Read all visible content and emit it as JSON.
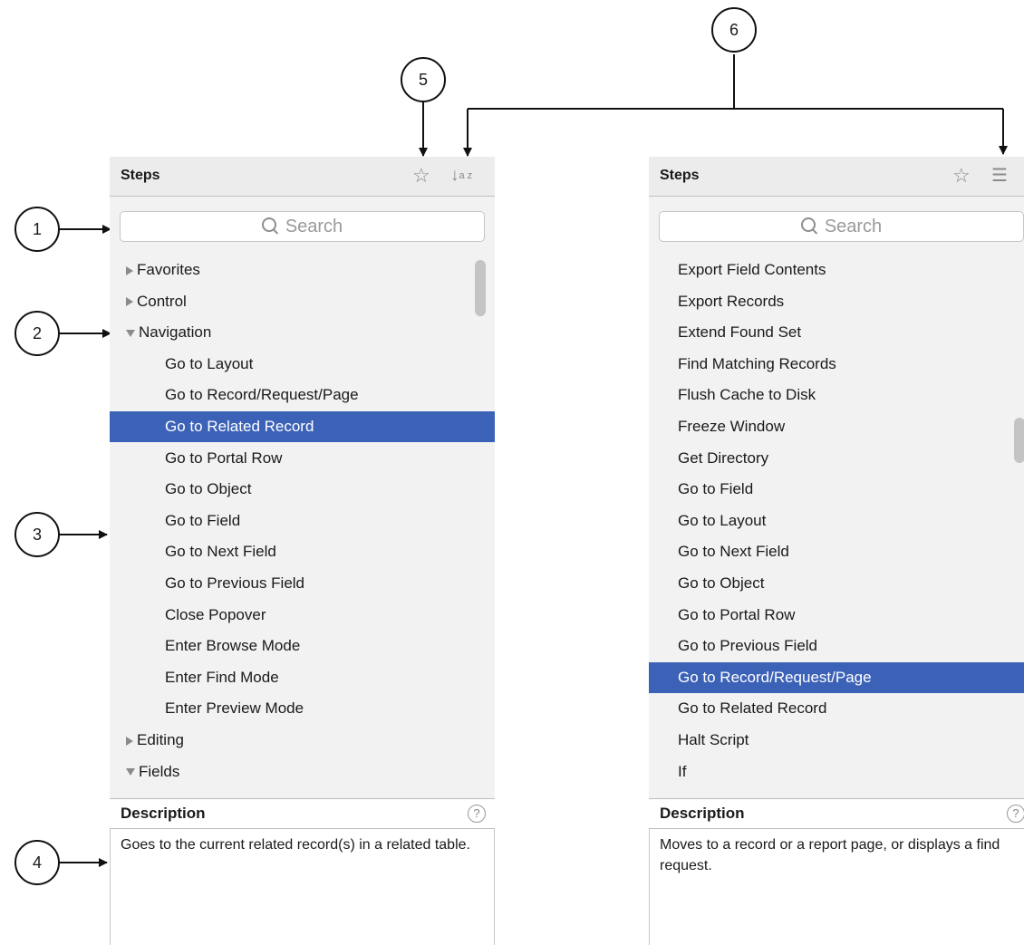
{
  "callouts": [
    "1",
    "2",
    "3",
    "4",
    "5",
    "6"
  ],
  "left_panel": {
    "title": "Steps",
    "favorite_icon": "star-icon",
    "sort_icon": "sort-alpha-icon",
    "search_placeholder": "Search",
    "items": [
      {
        "label": "Favorites",
        "level": 0,
        "state": "collapsed"
      },
      {
        "label": "Control",
        "level": 0,
        "state": "collapsed"
      },
      {
        "label": "Navigation",
        "level": 0,
        "state": "expanded"
      },
      {
        "label": "Go to Layout",
        "level": 1
      },
      {
        "label": "Go to Record/Request/Page",
        "level": 1
      },
      {
        "label": "Go to Related Record",
        "level": 1,
        "selected": true
      },
      {
        "label": "Go to Portal Row",
        "level": 1
      },
      {
        "label": "Go to Object",
        "level": 1
      },
      {
        "label": "Go to Field",
        "level": 1
      },
      {
        "label": "Go to Next Field",
        "level": 1
      },
      {
        "label": "Go to Previous Field",
        "level": 1
      },
      {
        "label": "Close Popover",
        "level": 1
      },
      {
        "label": "Enter Browse Mode",
        "level": 1
      },
      {
        "label": "Enter Find Mode",
        "level": 1
      },
      {
        "label": "Enter Preview Mode",
        "level": 1
      },
      {
        "label": "Editing",
        "level": 0,
        "state": "collapsed"
      },
      {
        "label": "Fields",
        "level": 0,
        "state": "expanded"
      }
    ],
    "description_title": "Description",
    "description_text": "Goes to the current related record(s) in a related table."
  },
  "right_panel": {
    "title": "Steps",
    "favorite_icon": "star-icon",
    "view_icon": "list-view-icon",
    "search_placeholder": "Search",
    "items": [
      {
        "label": "Export Field Contents"
      },
      {
        "label": "Export Records"
      },
      {
        "label": "Extend Found Set"
      },
      {
        "label": "Find Matching Records"
      },
      {
        "label": "Flush Cache to Disk"
      },
      {
        "label": "Freeze Window"
      },
      {
        "label": "Get Directory"
      },
      {
        "label": "Go to Field"
      },
      {
        "label": "Go to Layout"
      },
      {
        "label": "Go to Next Field"
      },
      {
        "label": "Go to Object"
      },
      {
        "label": "Go to Portal Row"
      },
      {
        "label": "Go to Previous Field"
      },
      {
        "label": "Go to Record/Request/Page",
        "selected": true
      },
      {
        "label": "Go to Related Record"
      },
      {
        "label": "Halt Script"
      },
      {
        "label": "If"
      }
    ],
    "description_title": "Description",
    "description_text": "Moves to a record or a report page, or displays a find request."
  },
  "colors": {
    "selection": "#3c62b8",
    "panel_bg": "#f2f2f2",
    "header_bg": "#ececec"
  }
}
